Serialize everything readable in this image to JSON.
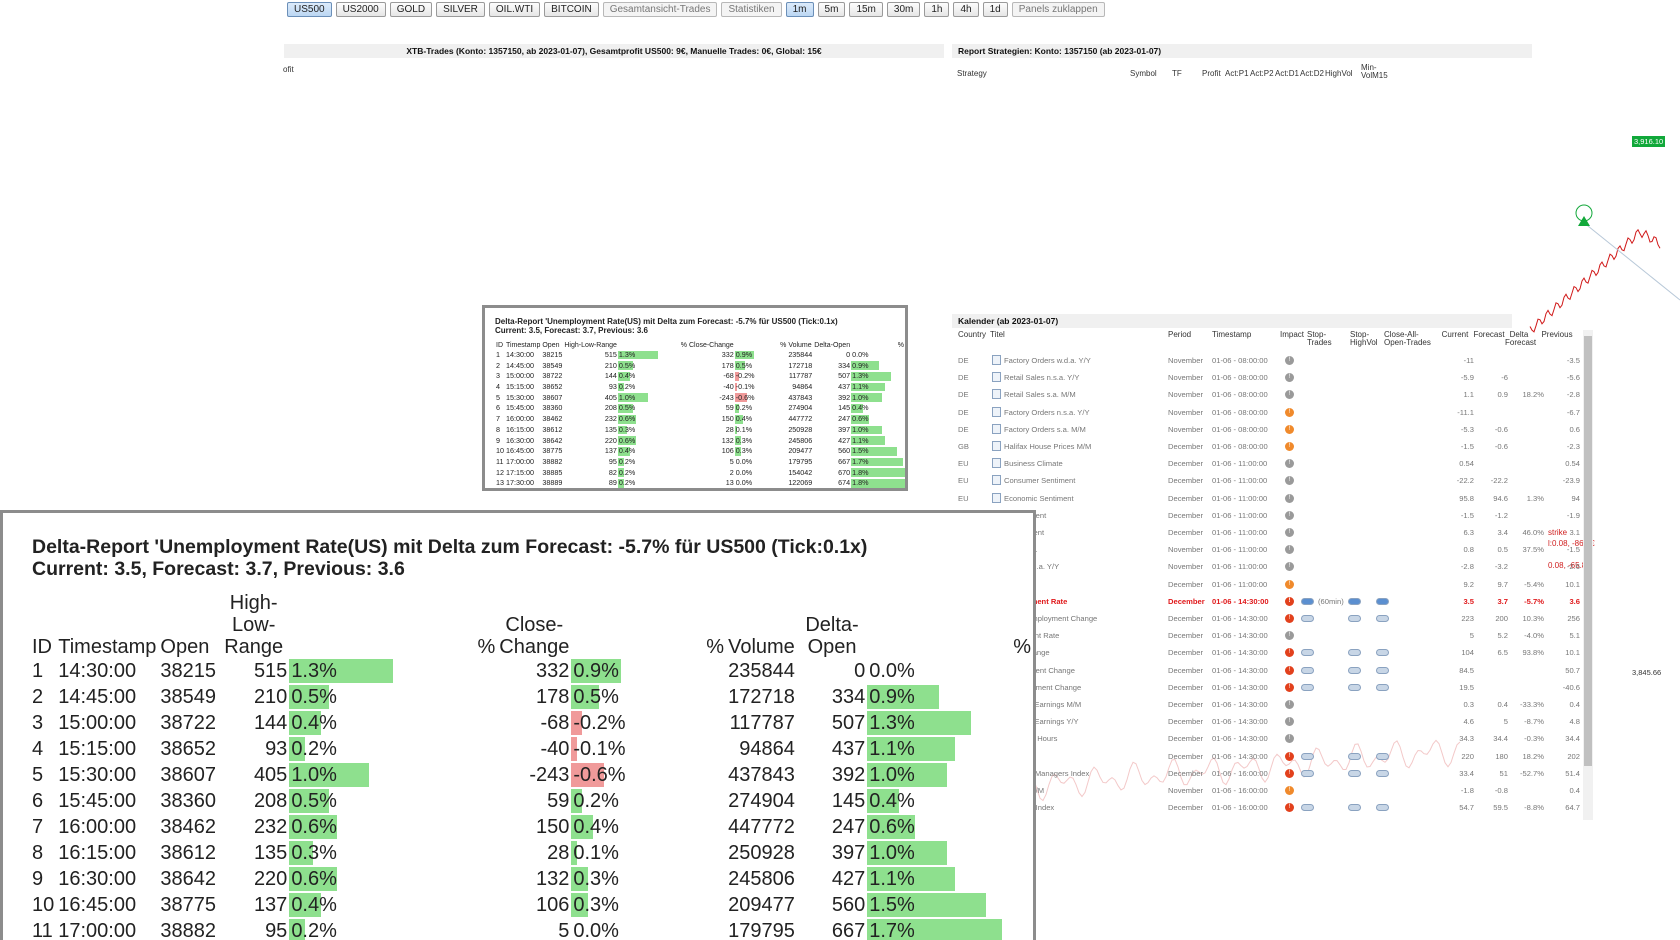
{
  "toolbar": {
    "buttons": [
      {
        "label": "US500",
        "active": true
      },
      {
        "label": "US2000"
      },
      {
        "label": "GOLD"
      },
      {
        "label": "SILVER"
      },
      {
        "label": "OIL.WTI"
      },
      {
        "label": "BITCOIN"
      },
      {
        "label": "Gesamtansicht-Trades",
        "dim": true
      },
      {
        "label": "Statistiken",
        "dim": true
      },
      {
        "label": "1m",
        "active": true
      },
      {
        "label": "5m"
      },
      {
        "label": "15m"
      },
      {
        "label": "30m"
      },
      {
        "label": "1h"
      },
      {
        "label": "4h"
      },
      {
        "label": "1d"
      },
      {
        "label": "Panels zuklappen",
        "dim": true
      }
    ]
  },
  "xtb_panel": {
    "title": "XTB-Trades (Konto: 1357150, ab 2023-01-07), Gesamtprofit US500: 9€, Manuelle Trades: 0€, Global: 15€",
    "fragment": "ofit"
  },
  "strategy_panel": {
    "title": "Report Strategien: Konto: 1357150 (ab 2023-01-07)",
    "columns": [
      "Strategy",
      "Symbol",
      "TF",
      "Profit",
      "Act:P1",
      "Act:P2",
      "Act:D1",
      "Act:D2",
      "HighVol",
      "Min-VolM15"
    ]
  },
  "price_labels": {
    "green": "3,916.10",
    "gray": "3,845.66"
  },
  "right_annotations": [
    "strike",
    "l:0.08, -86.7€",
    "0.08, -65.8€"
  ],
  "delta_report": {
    "title_line1": "Delta-Report 'Unemployment Rate(US) mit Delta zum Forecast: -5.7% für US500 (Tick:0.1x)",
    "title_line2": "Current: 3.5, Forecast: 3.7, Previous: 3.6",
    "headers": {
      "id": "ID",
      "timestamp": "Timestamp",
      "open": "Open",
      "hlr": "High-Low-Range",
      "pct1": "%",
      "close_change": "Close-Change",
      "pct2": "%",
      "volume": "Volume",
      "delta_open": "Delta-Open",
      "pct3": "%"
    },
    "rows": [
      {
        "id": "1",
        "ts": "14:30:00",
        "open": "38215",
        "hlr": "515",
        "hlr_pct": "1.3%",
        "hlr_p": 1.3,
        "cc": "332",
        "cc_pct": "0.9%",
        "cc_p": 0.9,
        "vol": "235844",
        "do": "0",
        "do_pct": "0.0%",
        "do_p": 0.0
      },
      {
        "id": "2",
        "ts": "14:45:00",
        "open": "38549",
        "hlr": "210",
        "hlr_pct": "0.5%",
        "hlr_p": 0.5,
        "cc": "178",
        "cc_pct": "0.5%",
        "cc_p": 0.5,
        "vol": "172718",
        "do": "334",
        "do_pct": "0.9%",
        "do_p": 0.9
      },
      {
        "id": "3",
        "ts": "15:00:00",
        "open": "38722",
        "hlr": "144",
        "hlr_pct": "0.4%",
        "hlr_p": 0.4,
        "cc": "-68",
        "cc_pct": "-0.2%",
        "cc_p": -0.2,
        "vol": "117787",
        "do": "507",
        "do_pct": "1.3%",
        "do_p": 1.3
      },
      {
        "id": "4",
        "ts": "15:15:00",
        "open": "38652",
        "hlr": "93",
        "hlr_pct": "0.2%",
        "hlr_p": 0.2,
        "cc": "-40",
        "cc_pct": "-0.1%",
        "cc_p": -0.1,
        "vol": "94864",
        "do": "437",
        "do_pct": "1.1%",
        "do_p": 1.1
      },
      {
        "id": "5",
        "ts": "15:30:00",
        "open": "38607",
        "hlr": "405",
        "hlr_pct": "1.0%",
        "hlr_p": 1.0,
        "cc": "-243",
        "cc_pct": "-0.6%",
        "cc_p": -0.6,
        "vol": "437843",
        "do": "392",
        "do_pct": "1.0%",
        "do_p": 1.0
      },
      {
        "id": "6",
        "ts": "15:45:00",
        "open": "38360",
        "hlr": "208",
        "hlr_pct": "0.5%",
        "hlr_p": 0.5,
        "cc": "59",
        "cc_pct": "0.2%",
        "cc_p": 0.2,
        "vol": "274904",
        "do": "145",
        "do_pct": "0.4%",
        "do_p": 0.4
      },
      {
        "id": "7",
        "ts": "16:00:00",
        "open": "38462",
        "hlr": "232",
        "hlr_pct": "0.6%",
        "hlr_p": 0.6,
        "cc": "150",
        "cc_pct": "0.4%",
        "cc_p": 0.4,
        "vol": "447772",
        "do": "247",
        "do_pct": "0.6%",
        "do_p": 0.6
      },
      {
        "id": "8",
        "ts": "16:15:00",
        "open": "38612",
        "hlr": "135",
        "hlr_pct": "0.3%",
        "hlr_p": 0.3,
        "cc": "28",
        "cc_pct": "0.1%",
        "cc_p": 0.1,
        "vol": "250928",
        "do": "397",
        "do_pct": "1.0%",
        "do_p": 1.0
      },
      {
        "id": "9",
        "ts": "16:30:00",
        "open": "38642",
        "hlr": "220",
        "hlr_pct": "0.6%",
        "hlr_p": 0.6,
        "cc": "132",
        "cc_pct": "0.3%",
        "cc_p": 0.3,
        "vol": "245806",
        "do": "427",
        "do_pct": "1.1%",
        "do_p": 1.1
      },
      {
        "id": "10",
        "ts": "16:45:00",
        "open": "38775",
        "hlr": "137",
        "hlr_pct": "0.4%",
        "hlr_p": 0.4,
        "cc": "106",
        "cc_pct": "0.3%",
        "cc_p": 0.3,
        "vol": "209477",
        "do": "560",
        "do_pct": "1.5%",
        "do_p": 1.5
      },
      {
        "id": "11",
        "ts": "17:00:00",
        "open": "38882",
        "hlr": "95",
        "hlr_pct": "0.2%",
        "hlr_p": 0.2,
        "cc": "5",
        "cc_pct": "0.0%",
        "cc_p": 0.0,
        "vol": "179795",
        "do": "667",
        "do_pct": "1.7%",
        "do_p": 1.7
      },
      {
        "id": "12",
        "ts": "17:15:00",
        "open": "38885",
        "hlr": "82",
        "hlr_pct": "0.2%",
        "hlr_p": 0.2,
        "cc": "2",
        "cc_pct": "0.0%",
        "cc_p": 0.0,
        "vol": "154042",
        "do": "670",
        "do_pct": "1.8%",
        "do_p": 1.8
      },
      {
        "id": "13",
        "ts": "17:30:00",
        "open": "38889",
        "hlr": "89",
        "hlr_pct": "0.2%",
        "hlr_p": 0.2,
        "cc": "13",
        "cc_pct": "0.0%",
        "cc_p": 0.0,
        "vol": "122069",
        "do": "674",
        "do_pct": "1.8%",
        "do_p": 1.8
      }
    ]
  },
  "calendar": {
    "title": "Kalender (ab 2023-01-07)",
    "columns": {
      "country": "Country",
      "title": "Titel",
      "period": "Period",
      "timestamp": "Timestamp",
      "impact": "Impact",
      "stop_trades": "Stop-Trades",
      "stop_highvol": "Stop-HighVol",
      "close_all": "Close-All-Open-Trades",
      "current": "Current",
      "forecast": "Forecast",
      "delta_forecast": "Delta Forecast",
      "previous": "Previous"
    },
    "rows": [
      {
        "country": "DE",
        "title": "Factory Orders w.d.a. Y/Y",
        "period": "November",
        "ts": "01-06 - 08:00:00",
        "impact": "gray",
        "current": "-11",
        "forecast": "",
        "delta": "",
        "previous": "-3.5"
      },
      {
        "country": "DE",
        "title": "Retail Sales n.s.a. Y/Y",
        "period": "November",
        "ts": "01-06 - 08:00:00",
        "impact": "gray",
        "current": "-5.9",
        "forecast": "-6",
        "delta": "",
        "previous": "-5.6"
      },
      {
        "country": "DE",
        "title": "Retail Sales s.a. M/M",
        "period": "November",
        "ts": "01-06 - 08:00:00",
        "impact": "gray",
        "current": "1.1",
        "forecast": "0.9",
        "delta": "18.2%",
        "previous": "-2.8"
      },
      {
        "country": "DE",
        "title": "Factory Orders n.s.a. Y/Y",
        "period": "November",
        "ts": "01-06 - 08:00:00",
        "impact": "orange",
        "current": "-11.1",
        "forecast": "",
        "delta": "",
        "previous": "-6.7"
      },
      {
        "country": "DE",
        "title": "Factory Orders s.a. M/M",
        "period": "November",
        "ts": "01-06 - 08:00:00",
        "impact": "orange",
        "current": "-5.3",
        "forecast": "-0.6",
        "delta": "",
        "previous": "0.6"
      },
      {
        "country": "GB",
        "title": "Halifax House Prices M/M",
        "period": "December",
        "ts": "01-06 - 08:00:00",
        "impact": "orange",
        "current": "-1.5",
        "forecast": "-0.6",
        "delta": "",
        "previous": "-2.3"
      },
      {
        "country": "EU",
        "title": "Business Climate",
        "period": "December",
        "ts": "01-06 - 11:00:00",
        "impact": "gray",
        "current": "0.54",
        "forecast": "",
        "delta": "",
        "previous": "0.54"
      },
      {
        "country": "EU",
        "title": "Consumer Sentiment",
        "period": "December",
        "ts": "01-06 - 11:00:00",
        "impact": "gray",
        "current": "-22.2",
        "forecast": "-22.2",
        "delta": "",
        "previous": "-23.9"
      },
      {
        "country": "EU",
        "title": "Economic Sentiment",
        "period": "December",
        "ts": "01-06 - 11:00:00",
        "impact": "gray",
        "current": "95.8",
        "forecast": "94.6",
        "delta": "1.3%",
        "previous": "94"
      },
      {
        "country": "",
        "title": "al Sentiment",
        "period": "December",
        "ts": "01-06 - 11:00:00",
        "impact": "gray",
        "current": "-1.5",
        "forecast": "-1.2",
        "delta": "",
        "previous": "-1.9"
      },
      {
        "country": "",
        "title": "s Sentiment",
        "period": "December",
        "ts": "01-06 - 11:00:00",
        "impact": "gray",
        "current": "6.3",
        "forecast": "3.4",
        "delta": "46.0%",
        "previous": "3.1"
      },
      {
        "country": "",
        "title": "Sales s.a.",
        "period": "November",
        "ts": "01-06 - 11:00:00",
        "impact": "gray",
        "current": "0.8",
        "forecast": "0.5",
        "delta": "37.5%",
        "previous": "-1.5"
      },
      {
        "country": "",
        "title": "Sales w.d.a. Y/Y",
        "period": "November",
        "ts": "01-06 - 11:00:00",
        "impact": "gray",
        "current": "-2.8",
        "forecast": "-3.2",
        "delta": "",
        "previous": "-2.6"
      },
      {
        "country": "",
        "title": "lash Y/Y",
        "period": "December",
        "ts": "01-06 - 11:00:00",
        "impact": "orange",
        "current": "9.2",
        "forecast": "9.7",
        "delta": "-5.4%",
        "previous": "10.1"
      },
      {
        "country": "",
        "title": "employment Rate",
        "period": "December",
        "ts": "01-06 - 14:30:00",
        "impact": "red",
        "current": "3.5",
        "forecast": "3.7",
        "delta": "-5.7%",
        "previous": "3.6",
        "highlight": true,
        "note": "(60min)"
      },
      {
        "country": "",
        "title": "-Farm Employment Change",
        "period": "December",
        "ts": "01-06 - 14:30:00",
        "impact": "red",
        "current": "223",
        "forecast": "200",
        "delta": "10.3%",
        "previous": "256"
      },
      {
        "country": "",
        "title": "mployment Rate",
        "period": "December",
        "ts": "01-06 - 14:30:00",
        "impact": "gray",
        "current": "5",
        "forecast": "5.2",
        "delta": "-4.0%",
        "previous": "5.1"
      },
      {
        "country": "",
        "title": "ment Change",
        "period": "December",
        "ts": "01-06 - 14:30:00",
        "impact": "red",
        "current": "104",
        "forecast": "6.5",
        "delta": "93.8%",
        "previous": "10.1"
      },
      {
        "country": "",
        "title": "Employment Change",
        "period": "December",
        "ts": "01-06 - 14:30:00",
        "impact": "red",
        "current": "84.5",
        "forecast": "",
        "delta": "",
        "previous": "50.7"
      },
      {
        "country": "",
        "title": "e Employment Change",
        "period": "December",
        "ts": "01-06 - 14:30:00",
        "impact": "red",
        "current": "19.5",
        "forecast": "",
        "delta": "",
        "previous": "-40.6"
      },
      {
        "country": "",
        "title": "e Hourly Earnings M/M",
        "period": "December",
        "ts": "01-06 - 14:30:00",
        "impact": "gray",
        "current": "0.3",
        "forecast": "0.4",
        "delta": "-33.3%",
        "previous": "0.4"
      },
      {
        "country": "",
        "title": "e Hourly Earnings Y/Y",
        "period": "December",
        "ts": "01-06 - 14:30:00",
        "impact": "gray",
        "current": "4.6",
        "forecast": "5",
        "delta": "-8.7%",
        "previous": "4.8"
      },
      {
        "country": "",
        "title": "e Weekly Hours",
        "period": "December",
        "ts": "01-06 - 14:30:00",
        "impact": "gray",
        "current": "34.3",
        "forecast": "34.4",
        "delta": "-0.3%",
        "previous": "34.4"
      },
      {
        "country": "",
        "title": "Payrolls",
        "period": "December",
        "ts": "01-06 - 14:30:00",
        "impact": "red",
        "current": "220",
        "forecast": "180",
        "delta": "18.2%",
        "previous": "202"
      },
      {
        "country": "",
        "title": "rchasing Managers Index",
        "period": "December",
        "ts": "01-06 - 16:00:00",
        "impact": "red",
        "current": "33.4",
        "forecast": "51",
        "delta": "-52.7%",
        "previous": "51.4"
      },
      {
        "country": "",
        "title": "Orders M/M",
        "period": "November",
        "ts": "01-06 - 16:00:00",
        "impact": "orange",
        "current": "-1.8",
        "forecast": "-0.8",
        "delta": "",
        "previous": "0.4"
      },
      {
        "country": "",
        "title": "s Activity Index",
        "period": "December",
        "ts": "01-06 - 16:00:00",
        "impact": "red",
        "current": "54.7",
        "forecast": "59.5",
        "delta": "-8.8%",
        "previous": "64.7"
      }
    ]
  },
  "colors": {
    "bar_pos": "#8ee08e",
    "bar_neg": "#f09a9a",
    "impact_gray": "#9a9a9a",
    "impact_orange": "#f08a2c",
    "impact_red": "#e2411d",
    "highlight": "#e0191b"
  }
}
